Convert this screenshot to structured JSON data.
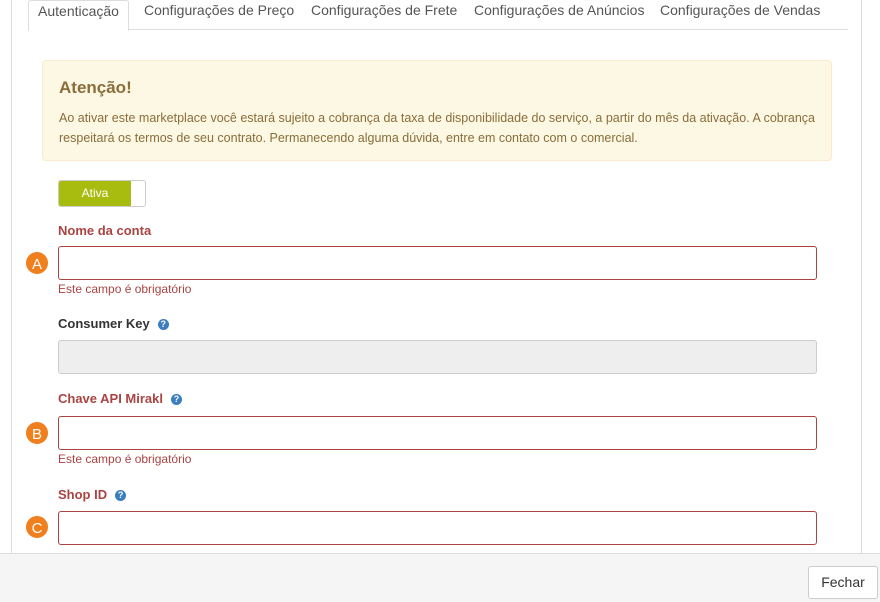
{
  "tabs": [
    {
      "label": "Autenticação",
      "active": true
    },
    {
      "label": "Configurações de Preço"
    },
    {
      "label": "Configurações de Frete"
    },
    {
      "label": "Configurações de Anúncios"
    },
    {
      "label": "Configurações de Vendas"
    }
  ],
  "alert": {
    "title": "Atenção!",
    "text": "Ao ativar este marketplace você estará sujeito a cobrança da taxa de disponibilidade do serviço, a partir do mês da ativação. A cobrança respeitará os termos de seu contrato. Permanecendo alguma dúvida, entre em contato com o comercial."
  },
  "toggle": {
    "label": "Ativa",
    "state": "on"
  },
  "fields": {
    "account_name": {
      "label": "Nome da conta",
      "value": "",
      "error": "Este campo é obrigatório"
    },
    "consumer_key": {
      "label": "Consumer Key",
      "value": ""
    },
    "mirakl_key": {
      "label": "Chave API Mirakl",
      "value": "",
      "error": "Este campo é obrigatório"
    },
    "shop_id": {
      "label": "Shop ID",
      "value": ""
    }
  },
  "markers": [
    "A",
    "B",
    "C"
  ],
  "footer": {
    "close_label": "Fechar"
  },
  "colors": {
    "toggle_on": "#a8bb0f",
    "error": "#a94442",
    "marker": "#f07f1e",
    "help": "#3b7dbf"
  }
}
